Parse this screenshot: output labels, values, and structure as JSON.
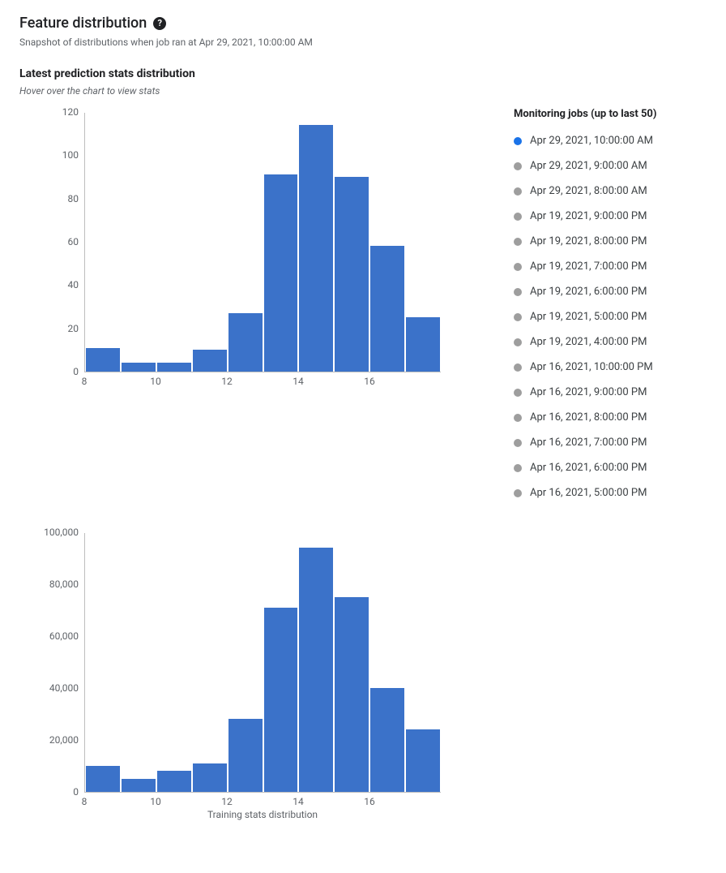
{
  "header": {
    "title": "Feature distribution",
    "help_glyph": "?",
    "snapshot": "Snapshot of distributions when job ran at Apr 29, 2021, 10:00:00 AM"
  },
  "section": {
    "title": "Latest prediction stats distribution",
    "hint": "Hover over the chart to view stats"
  },
  "jobs": {
    "title": "Monitoring jobs (up to last 50)",
    "items": [
      {
        "label": "Apr 29, 2021, 10:00:00 AM",
        "selected": true
      },
      {
        "label": "Apr 29, 2021, 9:00:00 AM",
        "selected": false
      },
      {
        "label": "Apr 29, 2021, 8:00:00 AM",
        "selected": false
      },
      {
        "label": "Apr 19, 2021, 9:00:00 PM",
        "selected": false
      },
      {
        "label": "Apr 19, 2021, 8:00:00 PM",
        "selected": false
      },
      {
        "label": "Apr 19, 2021, 7:00:00 PM",
        "selected": false
      },
      {
        "label": "Apr 19, 2021, 6:00:00 PM",
        "selected": false
      },
      {
        "label": "Apr 19, 2021, 5:00:00 PM",
        "selected": false
      },
      {
        "label": "Apr 19, 2021, 4:00:00 PM",
        "selected": false
      },
      {
        "label": "Apr 16, 2021, 10:00:00 PM",
        "selected": false
      },
      {
        "label": "Apr 16, 2021, 9:00:00 PM",
        "selected": false
      },
      {
        "label": "Apr 16, 2021, 8:00:00 PM",
        "selected": false
      },
      {
        "label": "Apr 16, 2021, 7:00:00 PM",
        "selected": false
      },
      {
        "label": "Apr 16, 2021, 6:00:00 PM",
        "selected": false
      },
      {
        "label": "Apr 16, 2021, 5:00:00 PM",
        "selected": false
      }
    ]
  },
  "chart_data": [
    {
      "id": "prediction",
      "type": "bar",
      "categories": [
        8,
        9,
        10,
        11,
        12,
        13,
        14,
        15,
        16,
        17
      ],
      "values": [
        11,
        4,
        4,
        10,
        27,
        91,
        114,
        90,
        58,
        25
      ],
      "x_ticks": [
        8,
        10,
        12,
        14,
        16
      ],
      "y_ticks": [
        0,
        20,
        40,
        60,
        80,
        100,
        120
      ],
      "ylim": [
        0,
        120
      ],
      "title": "",
      "xlabel": "",
      "ylabel": ""
    },
    {
      "id": "training",
      "type": "bar",
      "categories": [
        8,
        9,
        10,
        11,
        12,
        13,
        14,
        15,
        16,
        17
      ],
      "values": [
        10000,
        5000,
        8000,
        11000,
        28000,
        71000,
        94000,
        75000,
        40000,
        24000
      ],
      "x_ticks": [
        8,
        10,
        12,
        14,
        16
      ],
      "y_ticks": [
        0,
        20000,
        40000,
        60000,
        80000,
        100000
      ],
      "ylim": [
        0,
        100000
      ],
      "title": "",
      "xlabel": "Training stats distribution",
      "ylabel": ""
    }
  ]
}
